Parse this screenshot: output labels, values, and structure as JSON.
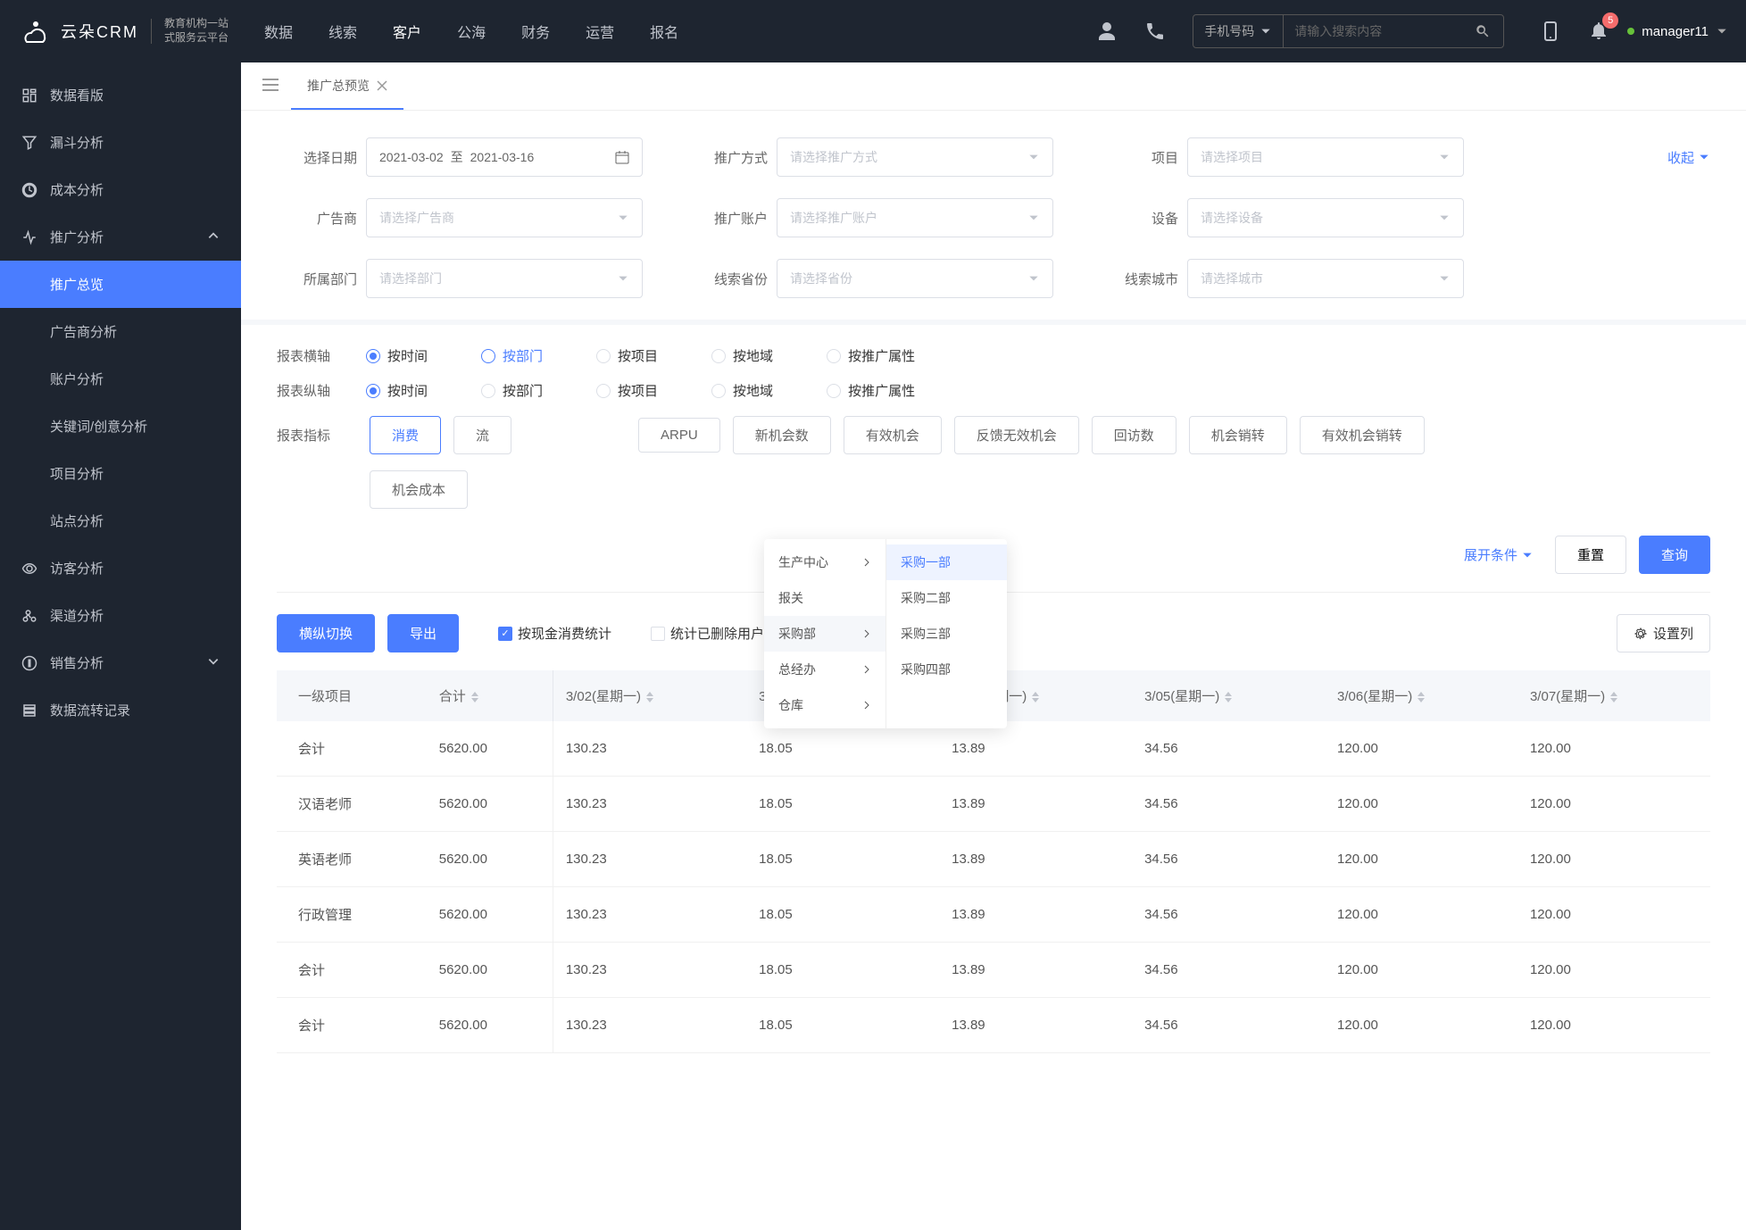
{
  "topnav": {
    "logo_text": "云朵CRM",
    "logo_sub1": "教育机构一站",
    "logo_sub2": "式服务云平台",
    "items": [
      "数据",
      "线索",
      "客户",
      "公海",
      "财务",
      "运营",
      "报名"
    ],
    "active_index": 2,
    "search_select": "手机号码",
    "search_placeholder": "请输入搜索内容",
    "badge": "5",
    "user": "manager11"
  },
  "sidebar": {
    "items": [
      {
        "label": "数据看版",
        "icon": "dashboard"
      },
      {
        "label": "漏斗分析",
        "icon": "funnel"
      },
      {
        "label": "成本分析",
        "icon": "cost"
      },
      {
        "label": "推广分析",
        "icon": "promo",
        "expanded": true,
        "children": [
          {
            "label": "推广总览",
            "active": true
          },
          {
            "label": "广告商分析"
          },
          {
            "label": "账户分析"
          },
          {
            "label": "关键词/创意分析"
          },
          {
            "label": "项目分析"
          },
          {
            "label": "站点分析"
          }
        ]
      },
      {
        "label": "访客分析",
        "icon": "visitor"
      },
      {
        "label": "渠道分析",
        "icon": "channel"
      },
      {
        "label": "销售分析",
        "icon": "sales",
        "collapsible": true
      },
      {
        "label": "数据流转记录",
        "icon": "flow"
      }
    ]
  },
  "tab": {
    "label": "推广总预览"
  },
  "filters": {
    "date_label": "选择日期",
    "date_from": "2021-03-02",
    "date_to": "2021-03-16",
    "date_sep": "至",
    "method_label": "推广方式",
    "method_placeholder": "请选择推广方式",
    "project_label": "项目",
    "project_placeholder": "请选择项目",
    "advertiser_label": "广告商",
    "advertiser_placeholder": "请选择广告商",
    "account_label": "推广账户",
    "account_placeholder": "请选择推广账户",
    "device_label": "设备",
    "device_placeholder": "请选择设备",
    "dept_label": "所属部门",
    "dept_placeholder": "请选择部门",
    "province_label": "线索省份",
    "province_placeholder": "请选择省份",
    "city_label": "线索城市",
    "city_placeholder": "请选择城市",
    "collapse": "收起"
  },
  "axis": {
    "h_label": "报表横轴",
    "v_label": "报表纵轴",
    "options": [
      "按时间",
      "按部门",
      "按项目",
      "按地域",
      "按推广属性"
    ],
    "h_checked": 0,
    "h_hover": 1,
    "v_checked": 0
  },
  "cascade": {
    "col1": [
      {
        "label": "生产中心",
        "has_children": true
      },
      {
        "label": "报关"
      },
      {
        "label": "采购部",
        "has_children": true,
        "active": true
      },
      {
        "label": "总经办",
        "has_children": true
      },
      {
        "label": "仓库",
        "has_children": true
      }
    ],
    "col2": [
      {
        "label": "采购一部",
        "selected": true
      },
      {
        "label": "采购二部"
      },
      {
        "label": "采购三部"
      },
      {
        "label": "采购四部"
      }
    ]
  },
  "metrics": {
    "label": "报表指标",
    "row1": [
      "消费",
      "流",
      "",
      "",
      "ARPU",
      "新机会数",
      "有效机会",
      "反馈无效机会",
      "回访数",
      "机会销转",
      "有效机会销转"
    ],
    "row2": [
      "机会成本",
      ""
    ],
    "active_index": 0
  },
  "actions": {
    "expand": "展开条件",
    "reset": "重置",
    "query": "查询"
  },
  "toolbar": {
    "switch": "横纵切换",
    "export": "导出",
    "cash_stat": "按现金消费统计",
    "deleted_stat": "统计已删除用户",
    "settings": "设置列"
  },
  "table": {
    "headers": [
      "一级项目",
      "合计",
      "3/02(星期一)",
      "3/03(星期一)",
      "3/04(星期一)",
      "3/05(星期一)",
      "3/06(星期一)",
      "3/07(星期一)"
    ],
    "rows": [
      [
        "会计",
        "5620.00",
        "130.23",
        "18.05",
        "13.89",
        "34.56",
        "120.00",
        "120.00"
      ],
      [
        "汉语老师",
        "5620.00",
        "130.23",
        "18.05",
        "13.89",
        "34.56",
        "120.00",
        "120.00"
      ],
      [
        "英语老师",
        "5620.00",
        "130.23",
        "18.05",
        "13.89",
        "34.56",
        "120.00",
        "120.00"
      ],
      [
        "行政管理",
        "5620.00",
        "130.23",
        "18.05",
        "13.89",
        "34.56",
        "120.00",
        "120.00"
      ],
      [
        "会计",
        "5620.00",
        "130.23",
        "18.05",
        "13.89",
        "34.56",
        "120.00",
        "120.00"
      ],
      [
        "会计",
        "5620.00",
        "130.23",
        "18.05",
        "13.89",
        "34.56",
        "120.00",
        "120.00"
      ]
    ]
  }
}
